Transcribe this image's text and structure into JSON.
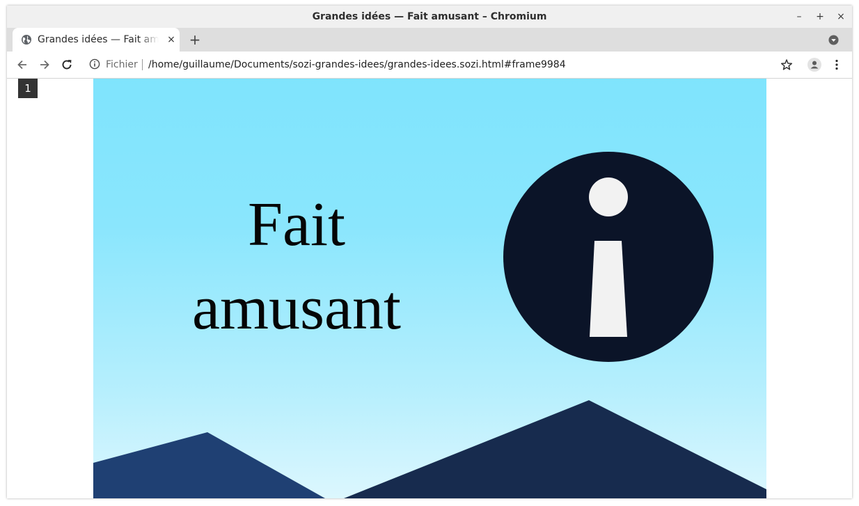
{
  "window": {
    "title": "Grandes idées — Fait amusant – Chromium",
    "controls": {
      "minimize": "–",
      "maximize": "+",
      "close": "×"
    }
  },
  "tabs": [
    {
      "title": "Grandes idées — Fait amusant",
      "icon": "globe-icon",
      "close": "×",
      "active": true
    }
  ],
  "tabstrip": {
    "new_tab": "+",
    "tab_search_icon": "chevron-down-circle-icon"
  },
  "toolbar": {
    "back_icon": "arrow-left-icon",
    "forward_icon": "arrow-right-icon",
    "reload_icon": "reload-icon",
    "site_info_icon": "info-circle-icon",
    "scheme_label": "Fichier",
    "url": "/home/guillaume/Documents/sozi-grandes-idees/grandes-idees.sozi.html#frame9984",
    "bookmark_icon": "star-icon",
    "profile_icon": "avatar-icon",
    "menu_icon": "kebab-menu-icon"
  },
  "presentation": {
    "frame_number": "1",
    "title_line1": "Fait",
    "title_line2": "amusant",
    "icon": "info-icon",
    "colors": {
      "sky_top": "#7fe4fd",
      "sky_bottom": "#dcf7fe",
      "circle": "#0b1428",
      "glyph": "#f2f2f2",
      "mountain_left": "#1f4073",
      "mountain_right": "#172b4e"
    }
  }
}
